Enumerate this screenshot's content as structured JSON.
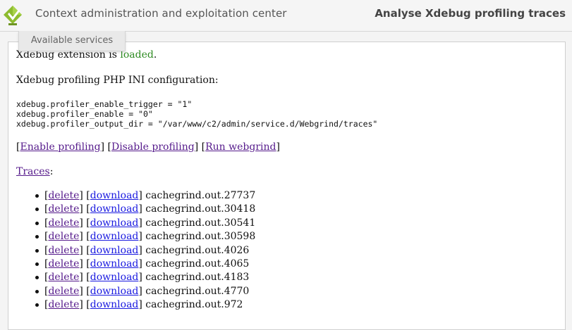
{
  "header": {
    "app_title": "Context administration and exploitation center",
    "page_heading": "Analyse Xdebug profiling traces"
  },
  "services_tab": {
    "label": "Available services"
  },
  "status": {
    "prefix": "Xdebug extension is ",
    "state": "loaded",
    "suffix": "."
  },
  "config": {
    "heading": "Xdebug profiling PHP INI configuration:",
    "lines": [
      "xdebug.profiler_enable_trigger = \"1\"",
      "xdebug.profiler_enable = \"0\"",
      "xdebug.profiler_output_dir = \"/var/www/c2/admin/service.d/Webgrind/traces\""
    ]
  },
  "actions": {
    "enable": "Enable profiling",
    "disable": "Disable profiling",
    "run": "Run webgrind"
  },
  "traces": {
    "label": "Traces",
    "suffix": ":",
    "delete_label": "delete",
    "download_label": "download",
    "files": [
      "cachegrind.out.27737",
      "cachegrind.out.30418",
      "cachegrind.out.30541",
      "cachegrind.out.30598",
      "cachegrind.out.4026",
      "cachegrind.out.4065",
      "cachegrind.out.4183",
      "cachegrind.out.4770",
      "cachegrind.out.972"
    ]
  },
  "colors": {
    "loaded": "#2e8b22",
    "visited_link": "#551a8b",
    "link": "#1a1ae0"
  }
}
